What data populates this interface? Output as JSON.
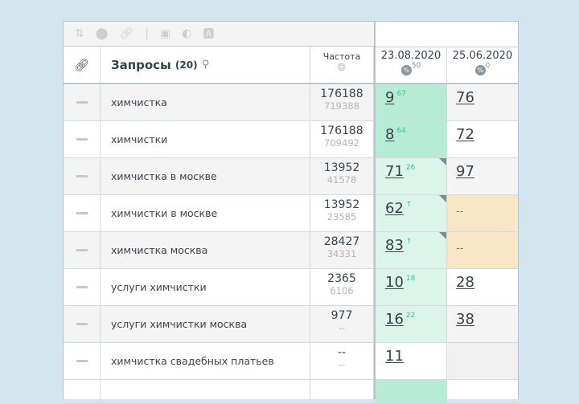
{
  "toolbar": {
    "icons": [
      "sort-icon",
      "toggle-icon",
      "link-icon",
      "calendar-icon",
      "contrast-icon",
      "font-icon"
    ]
  },
  "header": {
    "link_col": "link-icon",
    "queries_label": "Запросы",
    "queries_count": "(20)",
    "frequency_label": "Частота",
    "dates": [
      {
        "date": "23.08.2020",
        "pct": "50"
      },
      {
        "date": "25.06.2020",
        "pct": "0"
      }
    ]
  },
  "rows": [
    {
      "query": "химчистка",
      "freq": "176188",
      "freq2": "719388",
      "p1": "9",
      "d1": "67",
      "p2": "76",
      "c1": "g1",
      "c2": ""
    },
    {
      "query": "химчистки",
      "freq": "176188",
      "freq2": "709492",
      "p1": "8",
      "d1": "64",
      "p2": "72",
      "c1": "g1",
      "c2": ""
    },
    {
      "query": "химчистка в москве",
      "freq": "13952",
      "freq2": "41578",
      "p1": "71",
      "d1": "26",
      "p2": "97",
      "c1": "g2",
      "c2": ""
    },
    {
      "query": "химчистки в москве",
      "freq": "13952",
      "freq2": "23585",
      "p1": "62",
      "d1": "↑",
      "p2": "--",
      "c1": "g2",
      "c2": "or"
    },
    {
      "query": "химчистка москва",
      "freq": "28427",
      "freq2": "34331",
      "p1": "83",
      "d1": "↑",
      "p2": "--",
      "c1": "g2",
      "c2": "or"
    },
    {
      "query": "услуги химчистки",
      "freq": "2365",
      "freq2": "6106",
      "p1": "10",
      "d1": "18",
      "p2": "28",
      "c1": "g2",
      "c2": ""
    },
    {
      "query": "услуги химчистки москва",
      "freq": "977",
      "freq2": "--",
      "p1": "16",
      "d1": "22",
      "p2": "38",
      "c1": "g2",
      "c2": ""
    },
    {
      "query": "химчистка свадебных платьев",
      "freq": "--",
      "freq2": "--",
      "p1": "11",
      "d1": "",
      "p2": "",
      "c1": "",
      "c2": "gr"
    }
  ]
}
